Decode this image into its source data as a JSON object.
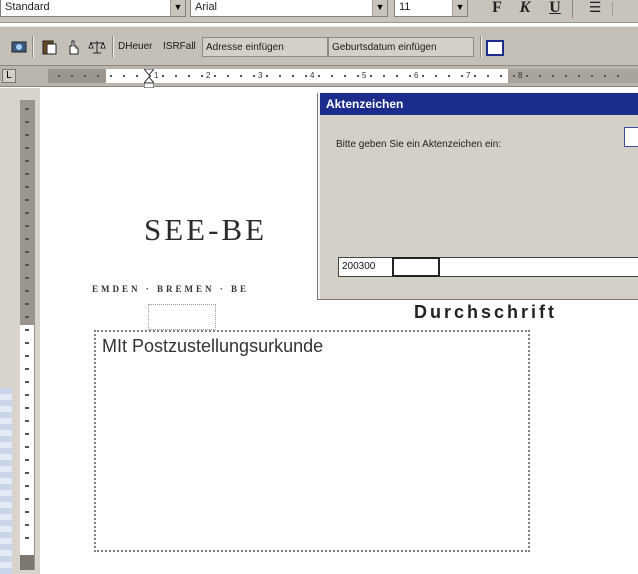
{
  "format_toolbar": {
    "style_value": "Standard",
    "font_value": "Arial",
    "size_value": "11",
    "bold_label": "F",
    "italic_label": "K",
    "underline_label": "U"
  },
  "toolbar2": {
    "btn_dheuer": "DHeuer",
    "btn_isrfall": "ISRFall",
    "btn_adresse": "Adresse einfügen",
    "btn_geburtsdatum": "Geburtsdatum einfügen"
  },
  "ruler": {
    "numbers": [
      "1",
      "2",
      "3",
      "4",
      "5",
      "6",
      "7",
      "8"
    ]
  },
  "document": {
    "letterhead": "SEE-BE",
    "subhead": "EMDEN · BREMEN · BE",
    "copy_label": "Durchschrift",
    "address_line": "MIt Postzustellungsurkunde"
  },
  "dialog": {
    "title": "Aktenzeichen",
    "prompt": "Bitte geben Sie ein Aktenzeichen ein:",
    "input_value": "200300"
  },
  "colors": {
    "title_bar": "#1c2c8c",
    "toolbar": "#c4c0b8",
    "dialog_bg": "#d4d0c8"
  },
  "icons": {
    "toolbar2": [
      "camera-icon",
      "paste-icon",
      "hand-icon",
      "balance-icon"
    ],
    "align": "align-left-icon"
  }
}
